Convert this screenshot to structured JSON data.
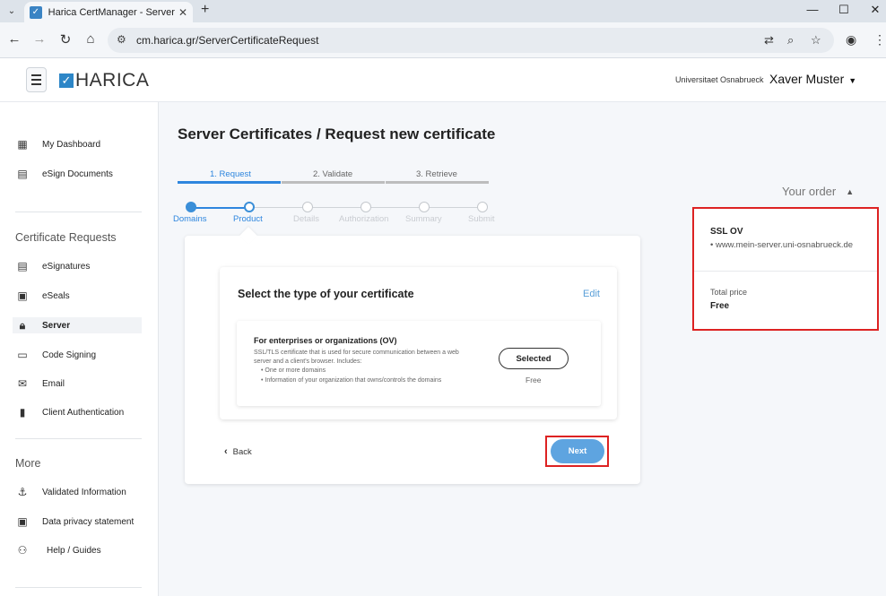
{
  "browser": {
    "tab_title": "Harica CertManager - Server Ce",
    "url": "cm.harica.gr/ServerCertificateRequest"
  },
  "header": {
    "logo": "HARICA",
    "organization": "Universitaet Osnabrueck",
    "user": "Xaver Muster"
  },
  "sidebar": {
    "top_items": [
      {
        "label": "My Dashboard",
        "icon": "dashboard-icon"
      },
      {
        "label": "eSign Documents",
        "icon": "esign-icon"
      }
    ],
    "requests_title": "Certificate Requests",
    "request_items": [
      {
        "label": "eSignatures",
        "icon": "esignature-icon"
      },
      {
        "label": "eSeals",
        "icon": "eseal-icon"
      },
      {
        "label": "Server",
        "icon": "lock-icon"
      },
      {
        "label": "Code Signing",
        "icon": "code-icon"
      },
      {
        "label": "Email",
        "icon": "email-icon"
      },
      {
        "label": "Client Authentication",
        "icon": "client-auth-icon"
      }
    ],
    "more_title": "More",
    "more_items": [
      {
        "label": "Validated Information",
        "icon": "anchor-icon"
      },
      {
        "label": "Data privacy statement",
        "icon": "privacy-icon"
      },
      {
        "label": "Help / Guides",
        "icon": "help-icon"
      }
    ]
  },
  "main": {
    "title": "Server Certificates / Request new certificate",
    "steps": [
      "1. Request",
      "2. Validate",
      "3. Retrieve"
    ],
    "progress": [
      "Domains",
      "Product",
      "Details",
      "Authorization",
      "Summary",
      "Submit"
    ],
    "card_title": "Select the type of your certificate",
    "edit": "Edit",
    "option": {
      "title": "For enterprises or organizations (OV)",
      "description": "SSL/TLS certificate that is used for secure communication between a web server and a client's browser. Includes:",
      "bullets": [
        "• One or more domains",
        "• Information of your organization that owns/controls the domains"
      ],
      "button": "Selected",
      "price": "Free"
    },
    "back": "Back",
    "next": "Next"
  },
  "order": {
    "title": "Your order",
    "product": "SSL OV",
    "domain": "• www.mein-server.uni-osnabrueck.de",
    "total_label": "Total price",
    "total_value": "Free"
  },
  "colors": {
    "accent": "#3b8fd8",
    "highlight": "#dd2222"
  }
}
